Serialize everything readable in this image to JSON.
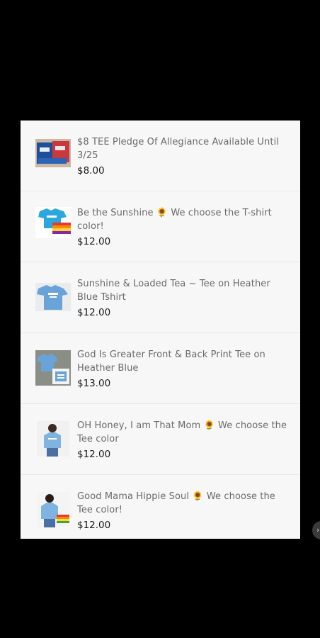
{
  "products": [
    {
      "title": "$8  TEE Pledge Of Allegiance Available Until 3/25",
      "price": "$8.00",
      "image_icon": "flag-shirts-photo"
    },
    {
      "title": "Be the Sunshine 🌻 We choose the T-shirt color!",
      "price": "$12.00",
      "image_icon": "blue-tshirt-rainbow-photo"
    },
    {
      "title": "Sunshine & Loaded Tea ~ Tee on Heather Blue Tshirt",
      "price": "$12.00",
      "image_icon": "heather-blue-tshirt-photo"
    },
    {
      "title": "God Is Greater Front & Back Print Tee on Heather Blue",
      "price": "$13.00",
      "image_icon": "front-back-tee-photo"
    },
    {
      "title": "OH Honey, I am That Mom 🌻 We choose the Tee color",
      "price": "$12.00",
      "image_icon": "woman-in-tee-photo"
    },
    {
      "title": "Good Mama Hippie Soul 🌻 We choose the Tee color!",
      "price": "$12.00",
      "image_icon": "woman-tee-rainbow-photo"
    }
  ],
  "carousel": {
    "next_icon": "chevron-right-icon",
    "next_glyph": "›"
  },
  "colors": {
    "backdrop": "#000000",
    "panel": "#f7f7f7",
    "title_text": "#6a6a6a",
    "price_text": "#1a1a1a",
    "tee_blue": "#6aa3d8"
  }
}
